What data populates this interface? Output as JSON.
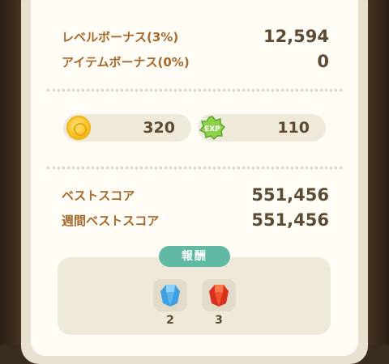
{
  "bonuses": [
    {
      "label": "レベルボーナス(3%)",
      "value": "12,594"
    },
    {
      "label": "アイテムボーナス(0%)",
      "value": "0"
    }
  ],
  "currencies": {
    "coin": {
      "icon": "coin-icon",
      "value": "320"
    },
    "exp": {
      "icon": "exp-icon",
      "badge": "EXP",
      "value": "110"
    }
  },
  "scores": [
    {
      "label": "ベストスコア",
      "value": "551,456"
    },
    {
      "label": "週間ベストスコア",
      "value": "551,456"
    }
  ],
  "reward": {
    "title": "報酬",
    "items": [
      {
        "icon": "blue-gem-icon",
        "count": "2"
      },
      {
        "icon": "red-gem-icon",
        "count": "3"
      }
    ]
  },
  "colors": {
    "label": "#a6692c",
    "value": "#5c4a32",
    "accent": "#5fb9a3",
    "coin": "#f7c325",
    "exp": "#8fd14f"
  }
}
